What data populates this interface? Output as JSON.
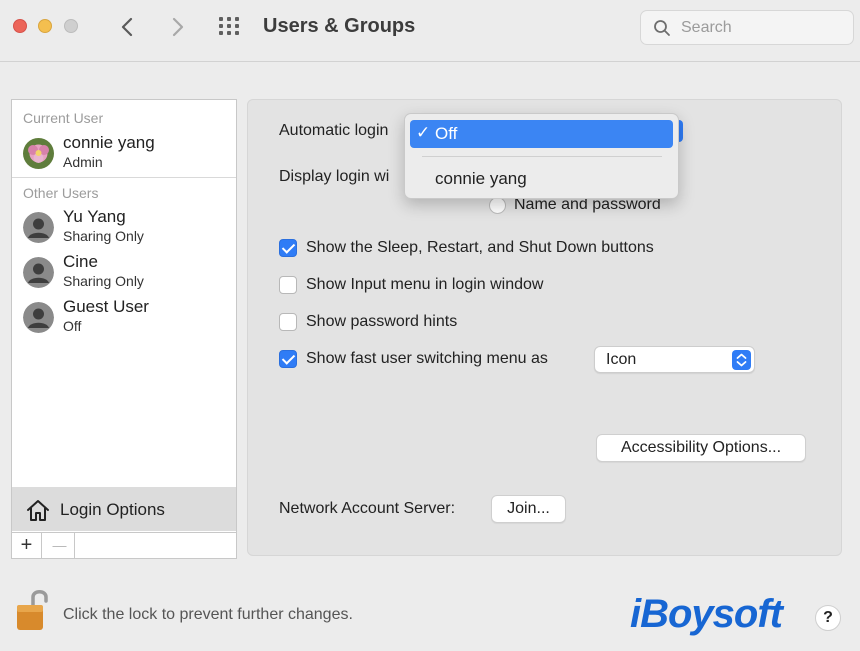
{
  "window": {
    "title": "Users & Groups"
  },
  "search": {
    "placeholder": "Search"
  },
  "sidebar": {
    "current_user_heading": "Current User",
    "current_user": {
      "name": "connie yang",
      "role": "Admin"
    },
    "other_users_heading": "Other Users",
    "other_users": [
      {
        "name": "Yu Yang",
        "role": "Sharing Only"
      },
      {
        "name": "Cine",
        "role": "Sharing Only"
      },
      {
        "name": "Guest User",
        "role": "Off"
      }
    ],
    "login_options_label": "Login Options",
    "add_label": "+",
    "remove_label": "—"
  },
  "panel": {
    "automatic_login_label": "Automatic login",
    "display_login_label": "Display login wi",
    "name_password_label": "Name and password",
    "show_sleep_label": "Show the Sleep, Restart, and Shut Down buttons",
    "show_sleep_checked": true,
    "show_input_menu_label": "Show Input menu in login window",
    "show_input_menu_checked": false,
    "show_hints_label": "Show password hints",
    "show_hints_checked": false,
    "fast_switch_label": "Show fast user switching menu as",
    "fast_switch_checked": true,
    "fast_switch_value": "Icon",
    "accessibility_button": "Accessibility Options...",
    "network_server_label": "Network Account Server:",
    "join_button": "Join..."
  },
  "auto_login_menu": {
    "check": "✓",
    "selected": "Off",
    "other_option": "connie yang"
  },
  "footer": {
    "lock_text": "Click the lock to prevent further changes.",
    "brand": "iBoysoft",
    "help": "?"
  },
  "colors": {
    "accent": "#2f7cf6",
    "menu_highlight": "#3b85f3",
    "brand": "#1766d3"
  }
}
